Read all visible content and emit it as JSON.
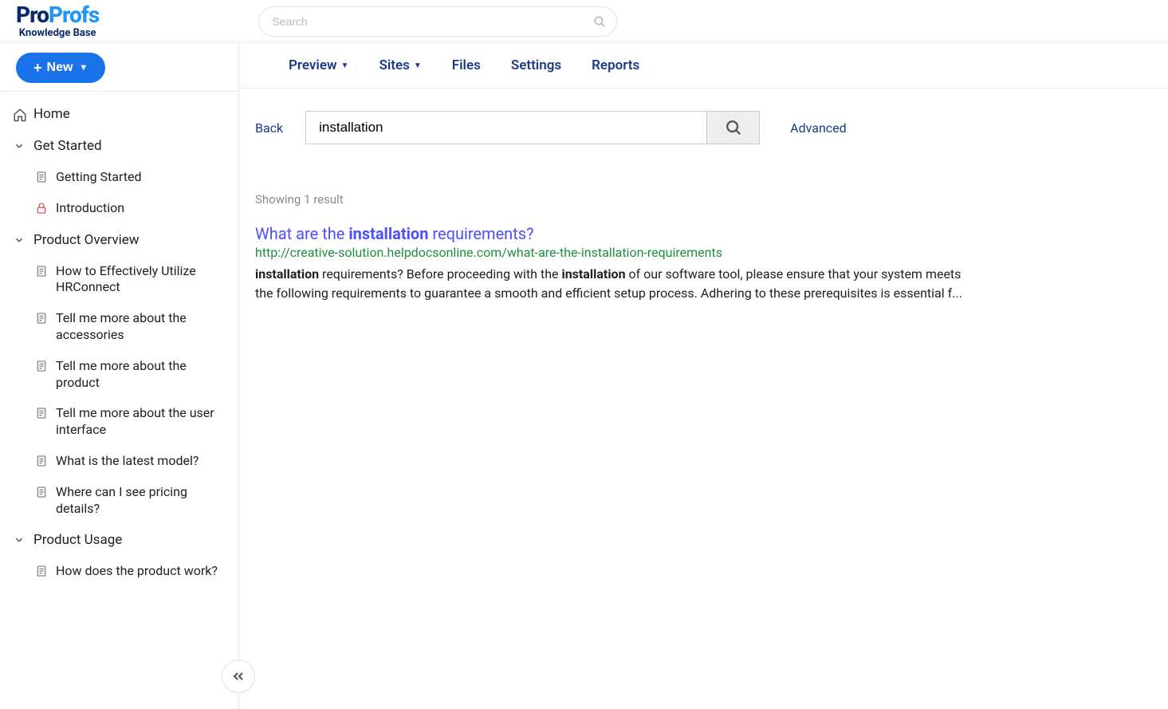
{
  "brand": {
    "part1": "Pro",
    "part2": "Profs",
    "subtitle": "Knowledge Base"
  },
  "topSearch": {
    "placeholder": "Search"
  },
  "newButton": {
    "label": "New"
  },
  "tree": {
    "home": "Home",
    "sections": [
      {
        "label": "Get Started",
        "items": [
          {
            "label": "Getting Started",
            "icon": "doc"
          },
          {
            "label": "Introduction",
            "icon": "lock"
          }
        ]
      },
      {
        "label": "Product Overview",
        "items": [
          {
            "label": "How to Effectively Utilize HRConnect",
            "icon": "doc"
          },
          {
            "label": "Tell me more about the accessories",
            "icon": "doc"
          },
          {
            "label": "Tell me more about the product",
            "icon": "doc"
          },
          {
            "label": "Tell me more about the user interface",
            "icon": "doc"
          },
          {
            "label": "What is the latest model?",
            "icon": "doc"
          },
          {
            "label": "Where can I see pricing details?",
            "icon": "doc"
          }
        ]
      },
      {
        "label": "Product Usage",
        "items": [
          {
            "label": "How does the product work?",
            "icon": "doc"
          }
        ]
      }
    ]
  },
  "tabs": {
    "preview": "Preview",
    "sites": "Sites",
    "files": "Files",
    "settings": "Settings",
    "reports": "Reports"
  },
  "search": {
    "back": "Back",
    "query": "installation",
    "advanced": "Advanced",
    "resultCount": "Showing 1 result"
  },
  "result": {
    "title_pre": "What are the ",
    "title_hl": "installation",
    "title_post": " requirements?",
    "url": "http://creative-solution.helpdocsonline.com/what-are-the-installation-requirements",
    "snippet_prehl1": "",
    "snippet_hl1": "installation",
    "snippet_mid1": " requirements? Before proceeding with the ",
    "snippet_hl2": "installation",
    "snippet_post": " of our software tool, please ensure that your system meets the following requirements to guarantee a smooth and efficient setup process. Adhering to these prerequisites is essential f..."
  }
}
